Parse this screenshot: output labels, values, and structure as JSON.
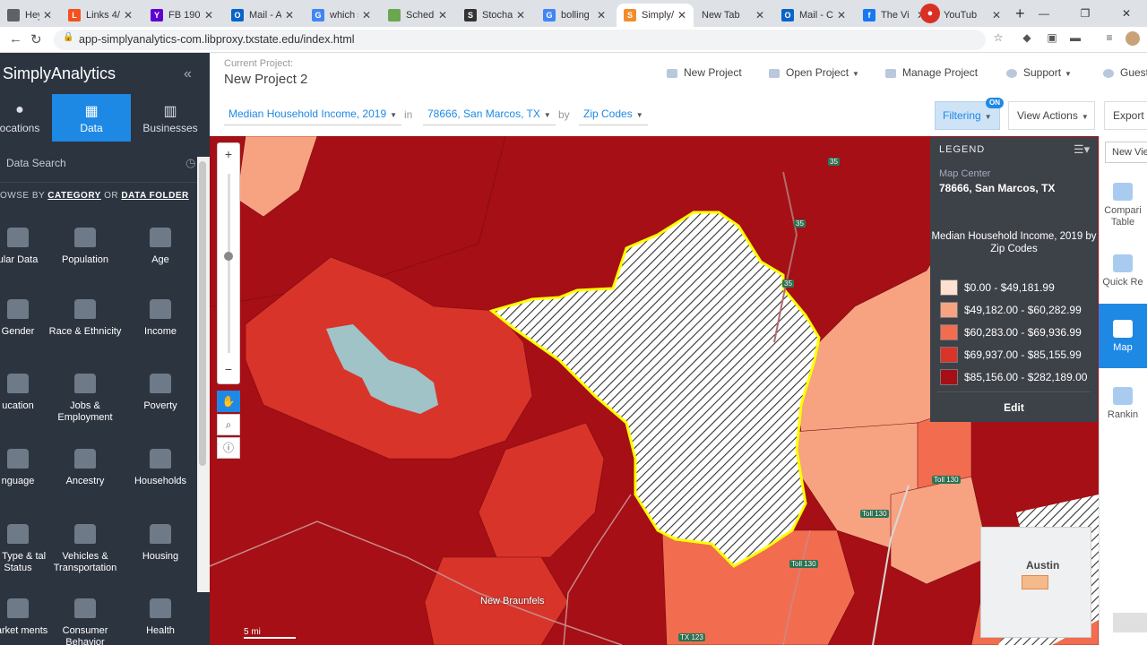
{
  "browser": {
    "tabs": [
      {
        "title": "Hey Nin",
        "fav": "tab-favicon-generic",
        "color": "#5f6368",
        "glyph": ""
      },
      {
        "title": "Links 4/",
        "fav": "tab-favicon-bookmark",
        "color": "#f4511e",
        "glyph": "L"
      },
      {
        "title": "FB 190.",
        "fav": "tab-favicon-yahoo",
        "color": "#6001d2",
        "glyph": "Y"
      },
      {
        "title": "Mail - A",
        "fav": "tab-favicon-outlook",
        "color": "#0a64c8",
        "glyph": "O"
      },
      {
        "title": "which s",
        "fav": "tab-favicon-google",
        "color": "#4285f4",
        "glyph": "G"
      },
      {
        "title": "Schedu",
        "fav": "tab-favicon-calendar",
        "color": "#6aa84f",
        "glyph": ""
      },
      {
        "title": "Stochas",
        "fav": "tab-favicon-chart",
        "color": "#333333",
        "glyph": "S"
      },
      {
        "title": "bolling",
        "fav": "tab-favicon-google",
        "color": "#4285f4",
        "glyph": "G"
      },
      {
        "title": "Simply/",
        "fav": "tab-favicon-simply",
        "color": "#f28c28",
        "glyph": "S"
      },
      {
        "title": "New Tab",
        "fav": "",
        "color": "",
        "glyph": ""
      },
      {
        "title": "Mail - C",
        "fav": "tab-favicon-outlook",
        "color": "#0a64c8",
        "glyph": "O"
      },
      {
        "title": "The Vi",
        "fav": "tab-favicon-facebook",
        "color": "#1877f2",
        "glyph": "f"
      },
      {
        "title": "YouTub",
        "fav": "",
        "color": "",
        "glyph": ""
      }
    ],
    "url": "app-simplyanalytics-com.libproxy.txstate.edu/index.html",
    "new_tab": "+",
    "back": "←",
    "forward": "→",
    "reload": "↻",
    "lock": "🔒"
  },
  "sidebar": {
    "title": "SimplyAnalytics",
    "collapse": "«",
    "nav": [
      {
        "label": "ocations",
        "icon": "location-pin-icon",
        "glyph": "⬤"
      },
      {
        "label": "Data",
        "icon": "grid-icon",
        "glyph": "▦"
      },
      {
        "label": "Businesses",
        "icon": "building-icon",
        "glyph": "▥"
      }
    ],
    "search_placeholder": "Data Search",
    "browse_prefix": "OWSE BY ",
    "browse_category": "CATEGORY",
    "browse_or": " OR ",
    "browse_folder": "DATA FOLDER",
    "categories": [
      {
        "label": "ular Data",
        "icon": "table-icon"
      },
      {
        "label": "Population",
        "icon": "people-icon"
      },
      {
        "label": "Age",
        "icon": "age-icon"
      },
      {
        "label": "Gender",
        "icon": "gender-icon"
      },
      {
        "label": "Race & Ethnicity",
        "icon": "race-icon"
      },
      {
        "label": "Income",
        "icon": "money-icon"
      },
      {
        "label": "ucation",
        "icon": "graduation-cap-icon"
      },
      {
        "label": "Jobs & Employment",
        "icon": "briefcase-icon"
      },
      {
        "label": "Poverty",
        "icon": "poverty-icon"
      },
      {
        "label": "nguage",
        "icon": "language-icon"
      },
      {
        "label": "Ancestry",
        "icon": "ancestry-icon"
      },
      {
        "label": "Households",
        "icon": "house-icon"
      },
      {
        "label": "ily Type & tal Status",
        "icon": "family-icon"
      },
      {
        "label": "Vehicles & Transportation",
        "icon": "bus-icon"
      },
      {
        "label": "Housing",
        "icon": "housing-icon"
      },
      {
        "label": "Market ments",
        "icon": "market-icon"
      },
      {
        "label": "Consumer Behavior",
        "icon": "cart-icon"
      },
      {
        "label": "Health",
        "icon": "heart-icon"
      }
    ]
  },
  "header": {
    "current_project_label": "Current Project:",
    "project_name": "New Project 2",
    "new_project": "New Project",
    "open_project": "Open Project",
    "manage_project": "Manage Project",
    "support": "Support",
    "guest": "Guest"
  },
  "toolbar": {
    "variable": "Median Household Income, 2019",
    "in": "in",
    "location": "78666, San Marcos, TX",
    "by": "by",
    "geography": "Zip Codes",
    "filtering": "Filtering",
    "filter_badge": "ON",
    "view_actions": "View Actions",
    "export": "Export"
  },
  "map": {
    "zoom_in": "+",
    "zoom_out": "−",
    "scale": "5 mi",
    "minimap_label": "Austin",
    "places": [
      "New Braunfels"
    ],
    "highways": [
      "35",
      "35",
      "35",
      "TX 123",
      "Toll 130",
      "Toll 130",
      "Toll 130"
    ],
    "colors": {
      "bin1": "#fde0d0",
      "bin2": "#f7a382",
      "bin3": "#f26d4f",
      "bin4": "#d9342a",
      "bin5": "#a50f15",
      "water": "#9fc3c7",
      "selected_outline": "#ffff00"
    }
  },
  "legend": {
    "title": "LEGEND",
    "map_center_label": "Map Center",
    "map_center": "78666, San Marcos, TX",
    "variable_title": "Median Household Income, 2019 by Zip Codes",
    "bins": [
      {
        "label": "$0.00 - $49,181.99",
        "color": "#fde0d0"
      },
      {
        "label": "$49,182.00 - $60,282.99",
        "color": "#f7a382"
      },
      {
        "label": "$60,283.00 - $69,936.99",
        "color": "#f26d4f"
      },
      {
        "label": "$69,937.00 - $85,155.99",
        "color": "#d9342a"
      },
      {
        "label": "$85,156.00 - $282,189.00",
        "color": "#a50f15"
      }
    ],
    "edit": "Edit"
  },
  "rail": {
    "new_view": "New Vie",
    "items": [
      {
        "label": "Compari Table",
        "icon": "comparison-table-icon"
      },
      {
        "label": "Quick Re",
        "icon": "quick-report-icon"
      },
      {
        "label": "Map",
        "icon": "map-icon"
      },
      {
        "label": "Rankin",
        "icon": "ranking-icon"
      }
    ]
  }
}
